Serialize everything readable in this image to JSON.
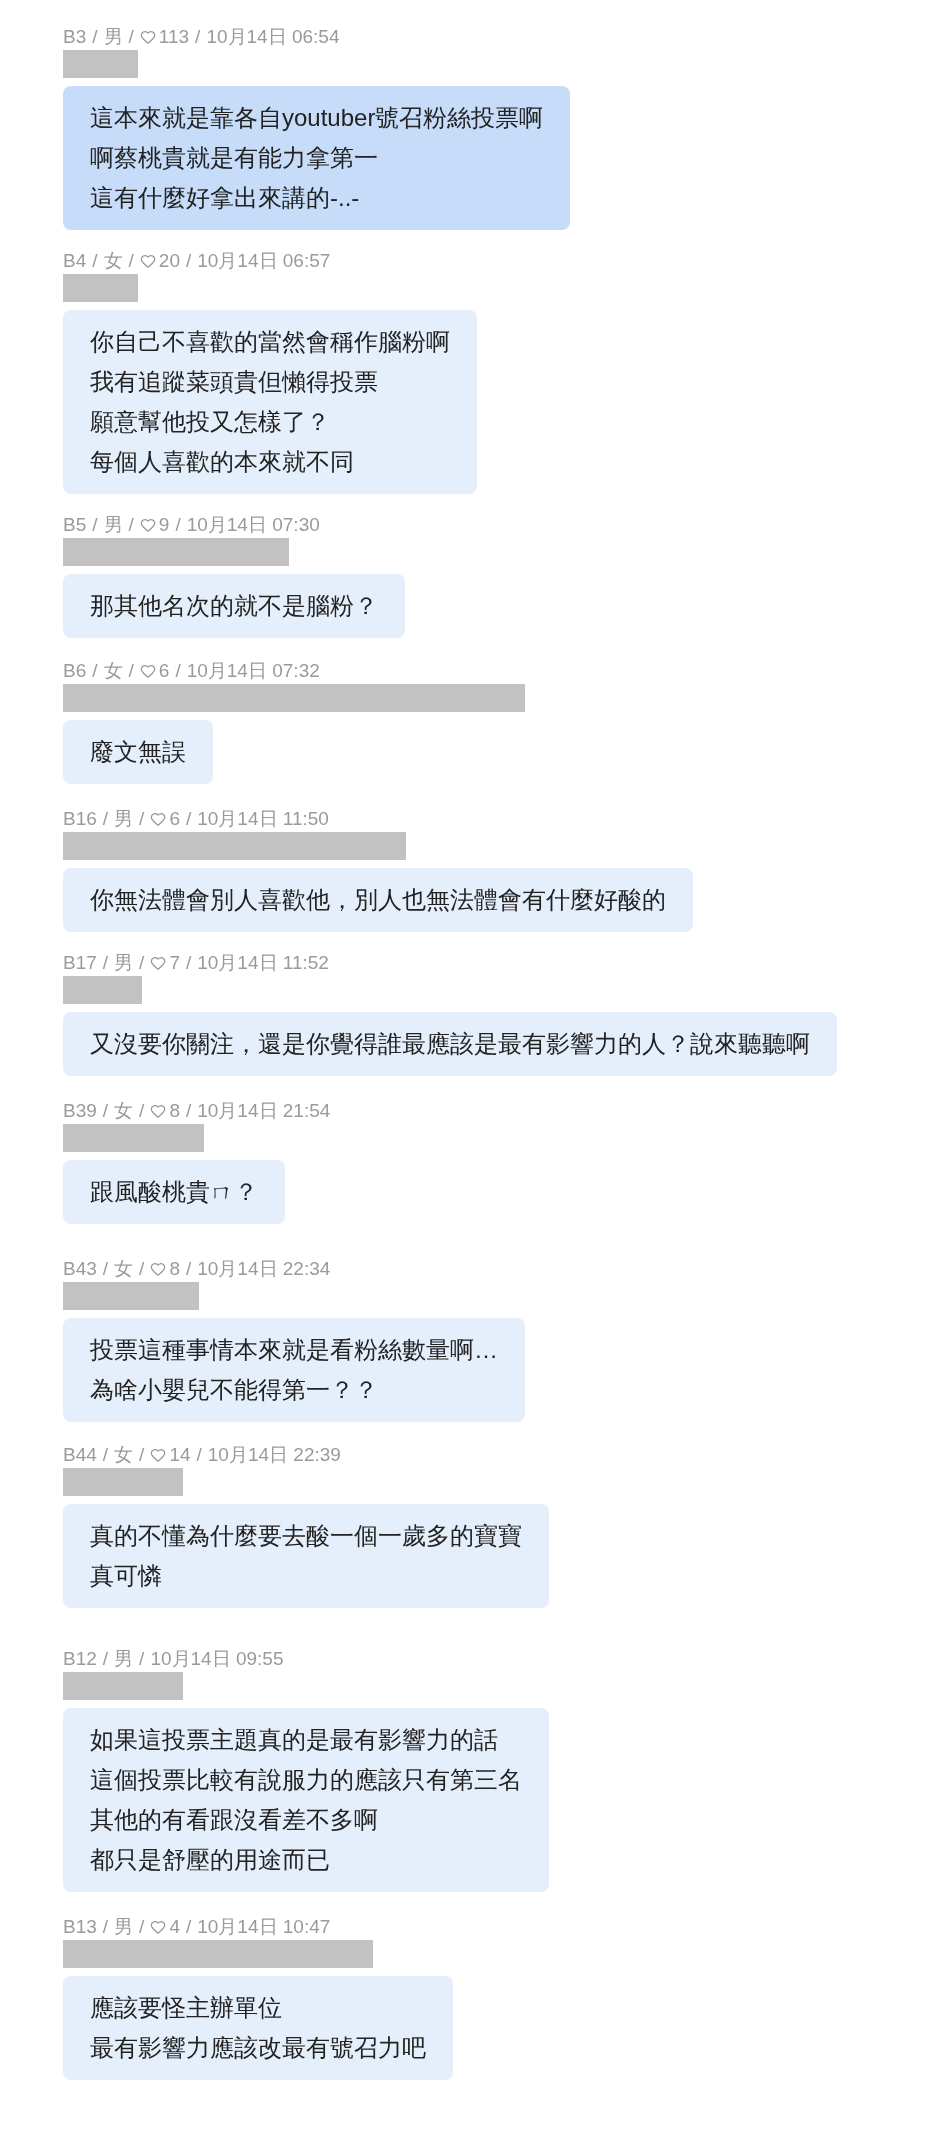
{
  "separator": "/",
  "comments": [
    {
      "floor": "B3",
      "gender": "男",
      "likes": "113",
      "time": "10月14日 06:54",
      "highlighted": true,
      "lines": [
        "這本來就是靠各自youtuber號召粉絲投票啊",
        "啊蔡桃貴就是有能力拿第一",
        "這有什麼好拿出來講的-..-"
      ]
    },
    {
      "floor": "B4",
      "gender": "女",
      "likes": "20",
      "time": "10月14日 06:57",
      "highlighted": false,
      "lines": [
        "你自己不喜歡的當然會稱作腦粉啊",
        "我有追蹤菜頭貴但懶得投票",
        "願意幫他投又怎樣了？",
        "每個人喜歡的本來就不同"
      ]
    },
    {
      "floor": "B5",
      "gender": "男",
      "likes": "9",
      "time": "10月14日 07:30",
      "highlighted": false,
      "lines": [
        "那其他名次的就不是腦粉？"
      ]
    },
    {
      "floor": "B6",
      "gender": "女",
      "likes": "6",
      "time": "10月14日 07:32",
      "highlighted": false,
      "lines": [
        "廢文無誤"
      ]
    },
    {
      "floor": "B16",
      "gender": "男",
      "likes": "6",
      "time": "10月14日 11:50",
      "highlighted": false,
      "lines": [
        "你無法體會別人喜歡他，別人也無法體會有什麼好酸的"
      ]
    },
    {
      "floor": "B17",
      "gender": "男",
      "likes": "7",
      "time": "10月14日 11:52",
      "highlighted": false,
      "lines": [
        "又沒要你關注，還是你覺得誰最應該是最有影響力的人？說來聽聽啊"
      ]
    },
    {
      "floor": "B39",
      "gender": "女",
      "likes": "8",
      "time": "10月14日 21:54",
      "highlighted": false,
      "lines": [
        "跟風酸桃貴ㄇ？"
      ]
    },
    {
      "floor": "B43",
      "gender": "女",
      "likes": "8",
      "time": "10月14日 22:34",
      "highlighted": false,
      "lines": [
        "投票這種事情本來就是看粉絲數量啊…",
        "為啥小嬰兒不能得第一？？"
      ]
    },
    {
      "floor": "B44",
      "gender": "女",
      "likes": "14",
      "time": "10月14日 22:39",
      "highlighted": false,
      "lines": [
        "真的不懂為什麼要去酸一個一歲多的寶寶",
        "真可憐"
      ]
    },
    {
      "floor": "B12",
      "gender": "男",
      "time": "10月14日 09:55",
      "highlighted": false,
      "lines": [
        "如果這投票主題真的是最有影響力的話",
        "這個投票比較有說服力的應該只有第三名",
        "其他的有看跟沒看差不多啊",
        "都只是舒壓的用途而已"
      ]
    },
    {
      "floor": "B13",
      "gender": "男",
      "likes": "4",
      "time": "10月14日 10:47",
      "highlighted": false,
      "lines": [
        "應該要怪主辦單位",
        "最有影響力應該改最有號召力吧"
      ]
    }
  ]
}
